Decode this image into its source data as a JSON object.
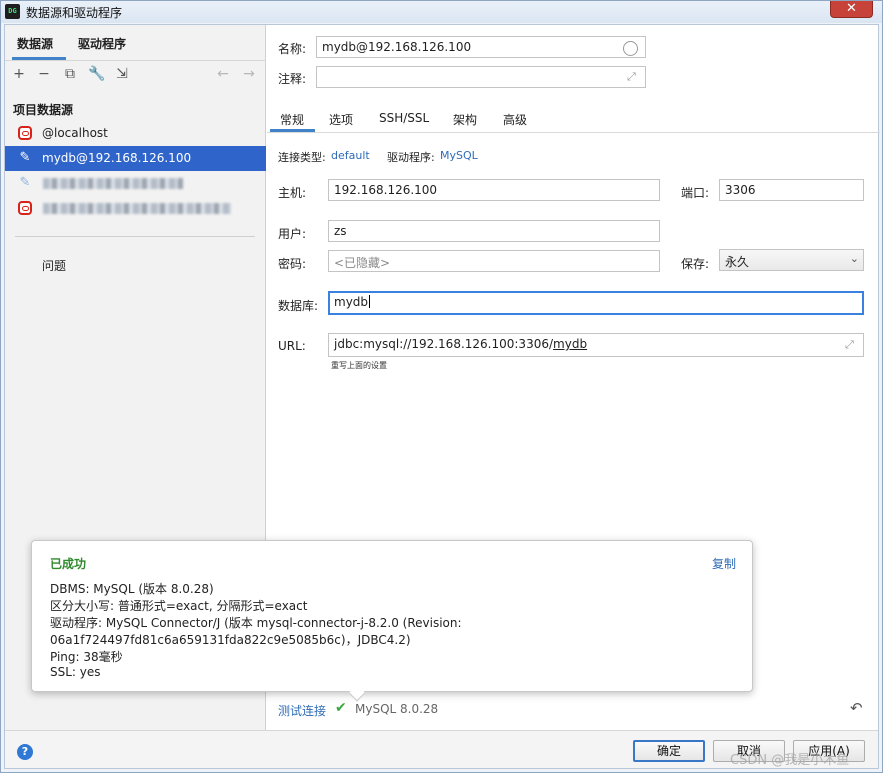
{
  "window": {
    "title": "数据源和驱动程序",
    "app_icon_text": "DG"
  },
  "left": {
    "tabs": [
      "数据源",
      "驱动程序"
    ],
    "toolbar": [
      "add-icon",
      "remove-icon",
      "duplicate-icon",
      "wrench-icon",
      "import-icon",
      "back-arrow-icon",
      "forward-arrow-icon"
    ],
    "heading": "项目数据源",
    "items": [
      {
        "label": "@localhost",
        "icon": "oracle-icon"
      },
      {
        "label": "mydb@192.168.126.100",
        "icon": "mysql-dolphin-icon",
        "selected": true
      },
      {
        "label": "",
        "icon": "mysql-dolphin-icon",
        "blurred": true
      },
      {
        "label": "",
        "icon": "oracle-icon",
        "blurred": true
      }
    ],
    "problems": "问题"
  },
  "form": {
    "name_label": "名称:",
    "name_value": "mydb@192.168.126.100",
    "comment_label": "注释:",
    "comment_value": "",
    "tabs": [
      "常规",
      "选项",
      "SSH/SSL",
      "架构",
      "高级"
    ],
    "conn_type_label": "连接类型:",
    "conn_type_value": "default",
    "driver_label": "驱动程序:",
    "driver_value": "MySQL",
    "host_label": "主机:",
    "host_value": "192.168.126.100",
    "port_label": "端口:",
    "port_value": "3306",
    "user_label": "用户:",
    "user_value": "zs",
    "password_label": "密码:",
    "password_placeholder": "<已隐藏>",
    "save_label": "保存:",
    "save_value": "永久",
    "database_label": "数据库:",
    "database_value": "mydb",
    "url_label": "URL:",
    "url_prefix": "jdbc:mysql://192.168.126.100:3306/",
    "url_db": "mydb",
    "url_hint": "重写上面的设置"
  },
  "popup": {
    "title": "已成功",
    "copy": "复制",
    "lines": [
      "DBMS: MySQL (版本 8.0.28)",
      "区分大小写: 普通形式=exact, 分隔形式=exact",
      "驱动程序: MySQL Connector/J (版本 mysql-connector-j-8.2.0 (Revision:",
      "06a1f724497fd81c6a659131fda822c9e5085b6c)，JDBC4.2)",
      "Ping: 38毫秒",
      "SSL: yes"
    ]
  },
  "footer": {
    "test_connection": "测试连接",
    "test_result": "MySQL 8.0.28",
    "help": "?",
    "ok": "确定",
    "cancel": "取消",
    "apply": "应用(A)"
  },
  "watermark": "CSDN @我是小木鱼",
  "colors": {
    "accent": "#2f65ca",
    "link": "#2f6cb5",
    "success": "#2f8a2b",
    "close": "#c7433a"
  }
}
